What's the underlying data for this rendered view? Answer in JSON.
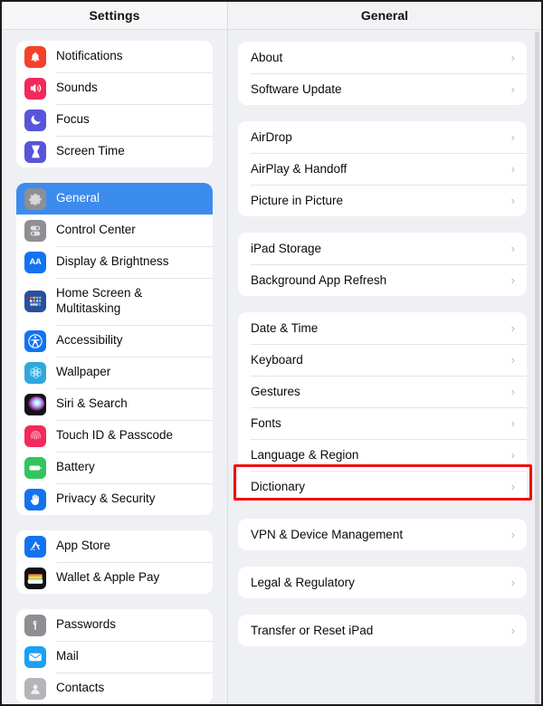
{
  "sidebar": {
    "title": "Settings",
    "groups": [
      {
        "items": [
          {
            "label": "Notifications",
            "icon": "notifications-icon"
          },
          {
            "label": "Sounds",
            "icon": "sounds-icon"
          },
          {
            "label": "Focus",
            "icon": "focus-icon"
          },
          {
            "label": "Screen Time",
            "icon": "screen-time-icon"
          }
        ]
      },
      {
        "items": [
          {
            "label": "General",
            "icon": "general-gear-icon",
            "selected": true
          },
          {
            "label": "Control Center",
            "icon": "control-center-icon"
          },
          {
            "label": "Display & Brightness",
            "icon": "display-brightness-icon"
          },
          {
            "label": "Home Screen & Multitasking",
            "icon": "home-screen-icon",
            "twoline": true
          },
          {
            "label": "Accessibility",
            "icon": "accessibility-icon"
          },
          {
            "label": "Wallpaper",
            "icon": "wallpaper-icon"
          },
          {
            "label": "Siri & Search",
            "icon": "siri-icon"
          },
          {
            "label": "Touch ID & Passcode",
            "icon": "touch-id-icon"
          },
          {
            "label": "Battery",
            "icon": "battery-icon"
          },
          {
            "label": "Privacy & Security",
            "icon": "privacy-security-icon"
          }
        ]
      },
      {
        "items": [
          {
            "label": "App Store",
            "icon": "app-store-icon"
          },
          {
            "label": "Wallet & Apple Pay",
            "icon": "wallet-icon"
          }
        ]
      },
      {
        "items": [
          {
            "label": "Passwords",
            "icon": "passwords-icon"
          },
          {
            "label": "Mail",
            "icon": "mail-icon"
          },
          {
            "label": "Contacts",
            "icon": "contacts-icon"
          }
        ]
      }
    ]
  },
  "detail": {
    "title": "General",
    "chevron": "›",
    "groups": [
      {
        "items": [
          {
            "label": "About"
          },
          {
            "label": "Software Update"
          }
        ]
      },
      {
        "items": [
          {
            "label": "AirDrop"
          },
          {
            "label": "AirPlay & Handoff"
          },
          {
            "label": "Picture in Picture"
          }
        ]
      },
      {
        "items": [
          {
            "label": "iPad Storage"
          },
          {
            "label": "Background App Refresh"
          }
        ]
      },
      {
        "items": [
          {
            "label": "Date & Time"
          },
          {
            "label": "Keyboard"
          },
          {
            "label": "Gestures"
          },
          {
            "label": "Fonts"
          },
          {
            "label": "Language & Region",
            "highlighted": true
          },
          {
            "label": "Dictionary"
          }
        ]
      },
      {
        "items": [
          {
            "label": "VPN & Device Management"
          }
        ]
      },
      {
        "items": [
          {
            "label": "Legal & Regulatory"
          }
        ]
      },
      {
        "items": [
          {
            "label": "Transfer or Reset iPad"
          }
        ]
      }
    ]
  },
  "colors": {
    "selected_row": "#3c8ced",
    "highlight_border": "#f20d0d",
    "page_background": "#eff0f4",
    "card_background": "#ffffff"
  }
}
